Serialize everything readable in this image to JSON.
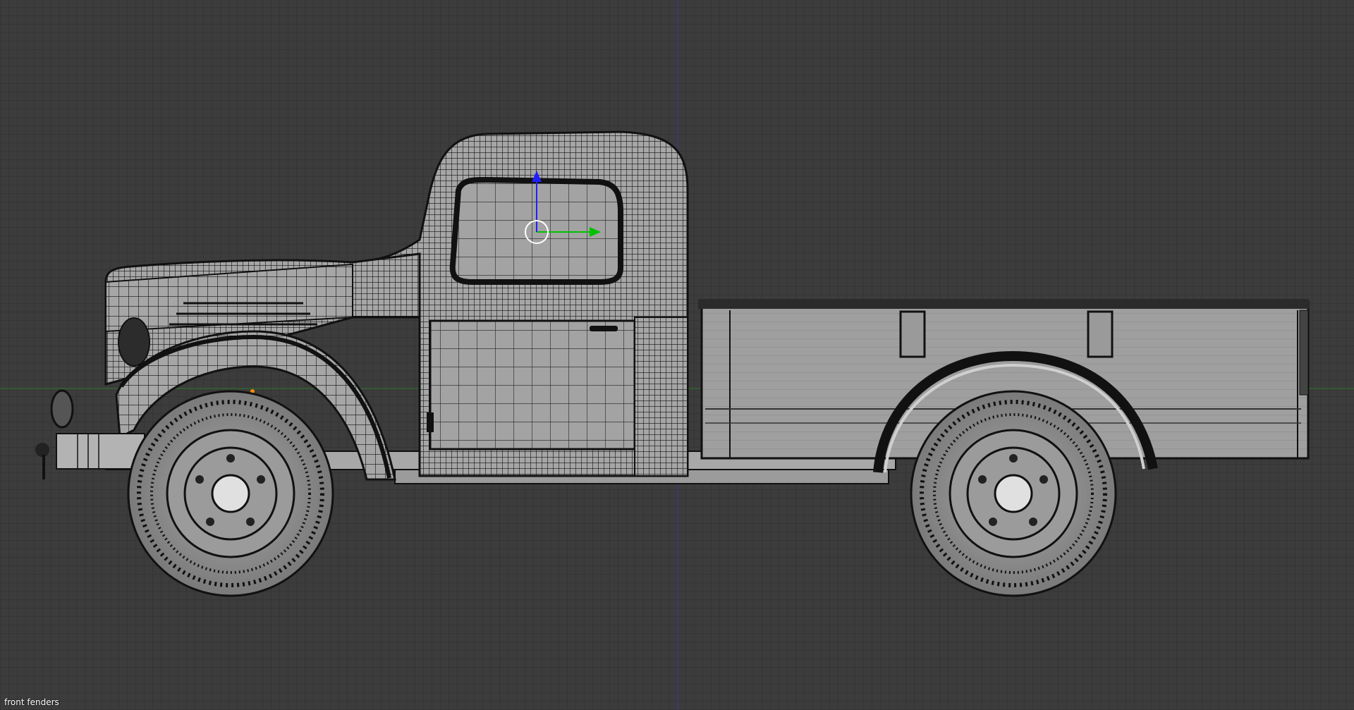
{
  "viewport": {
    "object_name": "front fenders",
    "colors": {
      "background": "#3c3c3c",
      "grid": "#353535",
      "x_axis": "#2d7a2d",
      "z_axis": "#3a3aa0",
      "mesh_face": "#a3a3a3",
      "mesh_wire": "#000000",
      "manipulator_x": "#00c000",
      "manipulator_z": "#2020ff",
      "pivot_ring": "#ffffff",
      "origin_dot": "#ff8c00"
    },
    "model": {
      "type": "pickup-truck-wireframe",
      "view": "side-orthographic"
    },
    "manipulator": {
      "type": "translate",
      "axes_visible": [
        "x",
        "z"
      ]
    }
  }
}
